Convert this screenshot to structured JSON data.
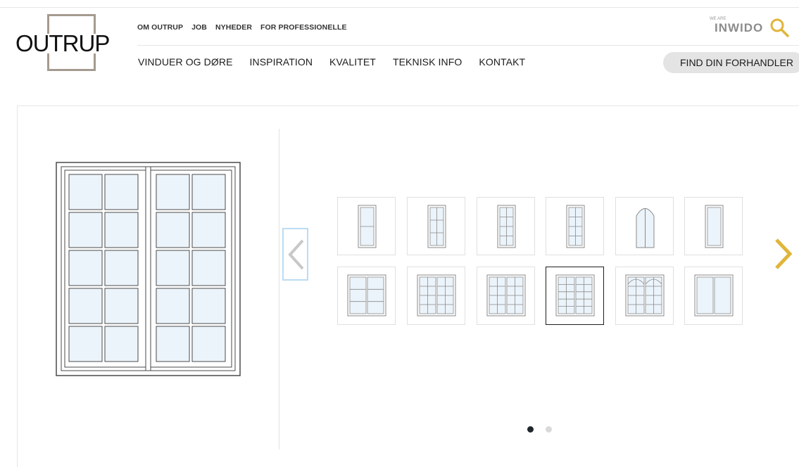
{
  "brand": {
    "logo_text": "OUTRUP",
    "group_tagline": "WE ARE",
    "group_name": "INWIDO"
  },
  "top_nav": [
    "OM OUTRUP",
    "JOB",
    "NYHEDER",
    "FOR PROFESSIONELLE"
  ],
  "main_nav": [
    "VINDUER OG DØRE",
    "INSPIRATION",
    "KVALITET",
    "TEKNISK INFO",
    "KONTAKT"
  ],
  "dealer_button": "FIND DIN FORHANDLER",
  "colors": {
    "logo_frame": "#a59a8f",
    "search_icon": "#e0b53a",
    "next_arrow": "#e0b53a",
    "prev_border": "#bcdcf3",
    "glass": "#ecf4fb",
    "dot_active": "#1f272c",
    "dot_inactive": "#d9d9d9"
  },
  "icons": {
    "search": "search-icon",
    "prev": "chevron-left-icon",
    "next": "chevron-right-icon"
  },
  "carousel": {
    "page": 1,
    "pages": 2,
    "selected_index": 9,
    "thumbnails": [
      "single-sash-2-panes",
      "single-sash-2x3-grid",
      "single-sash-2x4-grid",
      "single-sash-2x4-grid-fine",
      "single-sash-arched-split",
      "single-sash-plain",
      "double-sash-2x3-grid",
      "double-sash-3x4-grid",
      "double-sash-3x4-grid-b",
      "double-sash-2x5-grid",
      "double-sash-arched-grid",
      "double-sash-plain"
    ]
  }
}
